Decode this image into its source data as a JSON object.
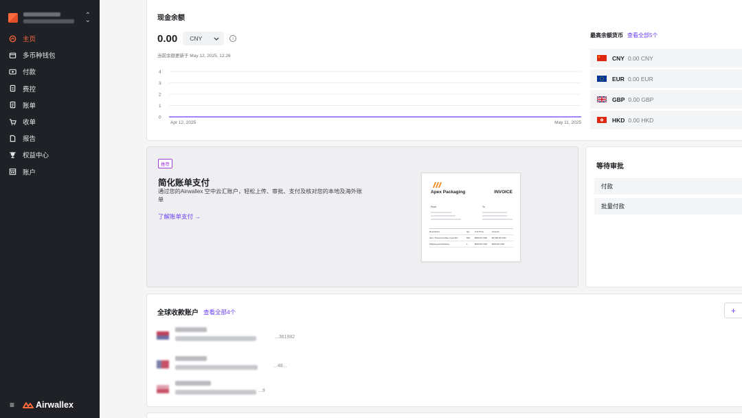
{
  "sidebar": {
    "nav": [
      {
        "label": "主页",
        "icon": "home-icon",
        "active": true
      },
      {
        "label": "多币种钱包",
        "icon": "wallet-icon"
      },
      {
        "label": "付款",
        "icon": "payment-icon"
      },
      {
        "label": "费控",
        "icon": "expense-icon"
      },
      {
        "label": "账单",
        "icon": "bill-icon"
      },
      {
        "label": "收单",
        "icon": "cart-icon"
      },
      {
        "label": "报告",
        "icon": "report-icon"
      },
      {
        "label": "权益中心",
        "icon": "trophy-icon"
      },
      {
        "label": "账户",
        "icon": "account-icon"
      }
    ],
    "brand": "Airwallex",
    "accent": "#ff6a3d"
  },
  "balance": {
    "title": "现金余额",
    "amount": "0.00",
    "currency": "CNY",
    "updated": "当前余额更新于 May 12, 2025, 12:26",
    "top_label": "最高余额货币",
    "view_all": "查看全部5个",
    "currencies": [
      {
        "code": "CNY",
        "balance": "0.00 CNY",
        "flag": "cn-flag"
      },
      {
        "code": "EUR",
        "balance": "0.00 EUR",
        "flag": "eu-flag"
      },
      {
        "code": "GBP",
        "balance": "0.00 GBP",
        "flag": "gb-flag"
      },
      {
        "code": "HKD",
        "balance": "0.00 HKD",
        "flag": "hk-flag"
      }
    ]
  },
  "chart_data": {
    "type": "line",
    "x_start": "Apr 12, 2025",
    "x_end": "May 11, 2025",
    "y_ticks": [
      "0",
      "1",
      "2",
      "3",
      "4"
    ],
    "ylim": [
      0,
      4
    ],
    "series": [
      {
        "values": [
          0,
          0
        ]
      }
    ],
    "line_color": "#6b3ef5",
    "grid": true
  },
  "promo": {
    "badge": "推荐",
    "title": "简化账单支付",
    "desc": "通过您的Airwallex 空中云汇账户，轻松上传、审批、支付及核对您的本地及海外账单",
    "link": "了解账单支付",
    "invoice": {
      "company": "Apex Packaging",
      "word": "INVOICE",
      "from": "From",
      "to": "To",
      "headers": [
        "Description",
        "Qty",
        "Unit Price",
        "Amount"
      ],
      "rows": [
        [
          "Item: Thermal Coffee Cups 8oz",
          "500",
          "$000.00 USD",
          "$0,000.00 USD"
        ],
        [
          "Shipping and Delivery",
          "1",
          "$000.00 USD",
          "$000.00 USD"
        ]
      ]
    }
  },
  "approvals": {
    "title": "等待审批",
    "items": [
      "付款",
      "批量付款"
    ]
  },
  "accounts": {
    "title": "全球收款账户",
    "view_all": "查看全部4个",
    "add": "+",
    "rows": [
      {
        "num": "...361982"
      },
      {
        "num": "...48..."
      },
      {
        "num": "...9"
      }
    ]
  }
}
